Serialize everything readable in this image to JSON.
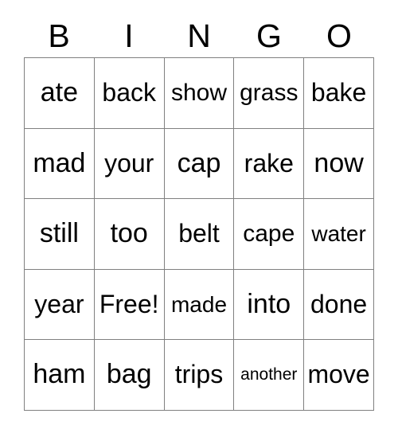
{
  "card": {
    "title": "BINGO",
    "header_letters": [
      "B",
      "I",
      "N",
      "G",
      "O"
    ],
    "free_space_label": "Free!",
    "colors": {
      "background": "#ffffff",
      "text": "#000000",
      "grid_line": "#808080"
    },
    "grid": {
      "rows": 5,
      "columns": 5,
      "cells": [
        [
          {
            "text": "ate",
            "size": "fs-xl"
          },
          {
            "text": "back",
            "size": "fs-lg"
          },
          {
            "text": "show",
            "size": "fs-md"
          },
          {
            "text": "grass",
            "size": "fs-md"
          },
          {
            "text": "bake",
            "size": "fs-lg"
          }
        ],
        [
          {
            "text": "mad",
            "size": "fs-xl"
          },
          {
            "text": "your",
            "size": "fs-lg"
          },
          {
            "text": "cap",
            "size": "fs-xl"
          },
          {
            "text": "rake",
            "size": "fs-lg"
          },
          {
            "text": "now",
            "size": "fs-xl"
          }
        ],
        [
          {
            "text": "still",
            "size": "fs-xl"
          },
          {
            "text": "too",
            "size": "fs-xl"
          },
          {
            "text": "belt",
            "size": "fs-lg"
          },
          {
            "text": "cape",
            "size": "fs-md"
          },
          {
            "text": "water",
            "size": "fs-sm"
          }
        ],
        [
          {
            "text": "year",
            "size": "fs-lg"
          },
          {
            "text": "Free!",
            "size": "fs-lg"
          },
          {
            "text": "made",
            "size": "fs-sm"
          },
          {
            "text": "into",
            "size": "fs-xl"
          },
          {
            "text": "done",
            "size": "fs-lg"
          }
        ],
        [
          {
            "text": "ham",
            "size": "fs-xl"
          },
          {
            "text": "bag",
            "size": "fs-xl"
          },
          {
            "text": "trips",
            "size": "fs-lg"
          },
          {
            "text": "another",
            "size": "fs-xs"
          },
          {
            "text": "move",
            "size": "fs-lg"
          }
        ]
      ]
    }
  }
}
